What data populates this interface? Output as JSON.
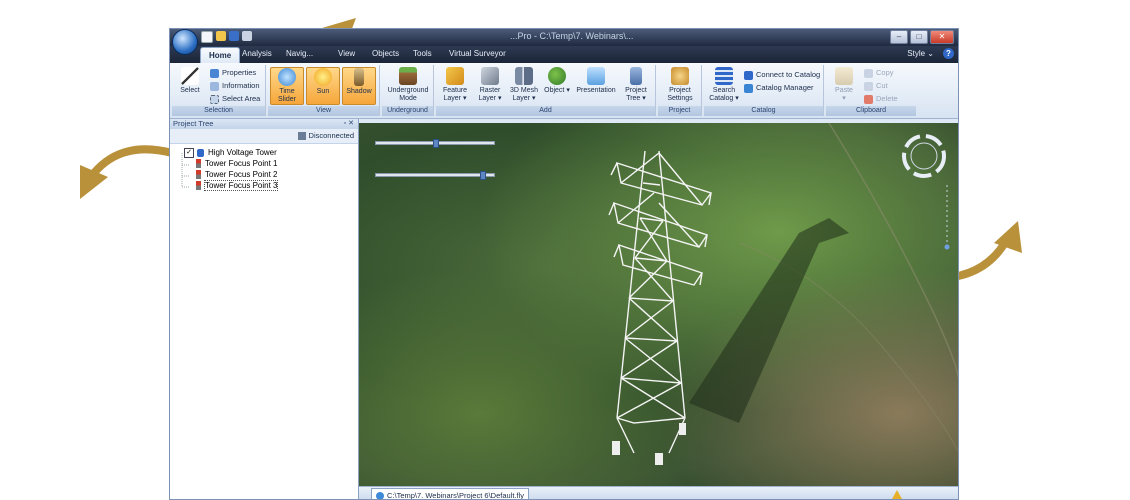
{
  "window": {
    "title": "...Pro - C:\\Temp\\7. Webinars\\...",
    "controls": [
      "minimize",
      "maximize",
      "close"
    ]
  },
  "tabs": [
    {
      "label": "Home",
      "active": true
    },
    {
      "label": "Analysis"
    },
    {
      "label": "Navig..."
    },
    {
      "label": "View"
    },
    {
      "label": "Objects"
    },
    {
      "label": "Tools"
    },
    {
      "label": "Virtual Surveyor"
    }
  ],
  "style_menu": "Style",
  "ribbon": {
    "selection": {
      "label": "Selection",
      "select": "Select",
      "properties": "Properties",
      "information": "Information",
      "select_area": "Select Area"
    },
    "view": {
      "label": "View",
      "time_slider_1": "Time",
      "time_slider_2": "Slider",
      "sun": "Sun",
      "shadow": "Shadow"
    },
    "underground": {
      "label": "Underground",
      "mode_1": "Underground",
      "mode_2": "Mode"
    },
    "add": {
      "label": "Add",
      "feature_1": "Feature",
      "feature_2": "Layer",
      "raster_1": "Raster",
      "raster_2": "Layer",
      "mesh_1": "3D Mesh",
      "mesh_2": "Layer",
      "object": "Object",
      "presentation": "Presentation",
      "tree_1": "Project",
      "tree_2": "Tree"
    },
    "project": {
      "label": "Project",
      "settings_1": "Project",
      "settings_2": "Settings"
    },
    "catalog": {
      "label": "Catalog",
      "search_1": "Search",
      "search_2": "Catalog",
      "connect": "Connect to Catalog",
      "manager": "Catalog Manager"
    },
    "clipboard": {
      "label": "Clipboard",
      "paste": "Paste",
      "copy": "Copy",
      "cut": "Cut",
      "delete": "Delete"
    }
  },
  "project_tree": {
    "title": "Project Tree",
    "controls": "▫ ✕",
    "status": "Disconnected",
    "items": [
      {
        "label": "High Voltage Tower",
        "checked": true
      },
      {
        "label": "Tower Focus Point 1"
      },
      {
        "label": "Tower Focus Point 2"
      },
      {
        "label": "Tower Focus Point 3",
        "selected": true
      }
    ]
  },
  "sliders": [
    {
      "value": 0.48
    },
    {
      "value": 0.88
    }
  ],
  "statusbar": {
    "doc_path": "C:\\Temp\\7. Webinars\\Project 6\\Default.fly"
  },
  "colors": {
    "arrow": "#b8913a",
    "ribbon_active": "#f6a63a",
    "terrain": "#3d5a33"
  }
}
